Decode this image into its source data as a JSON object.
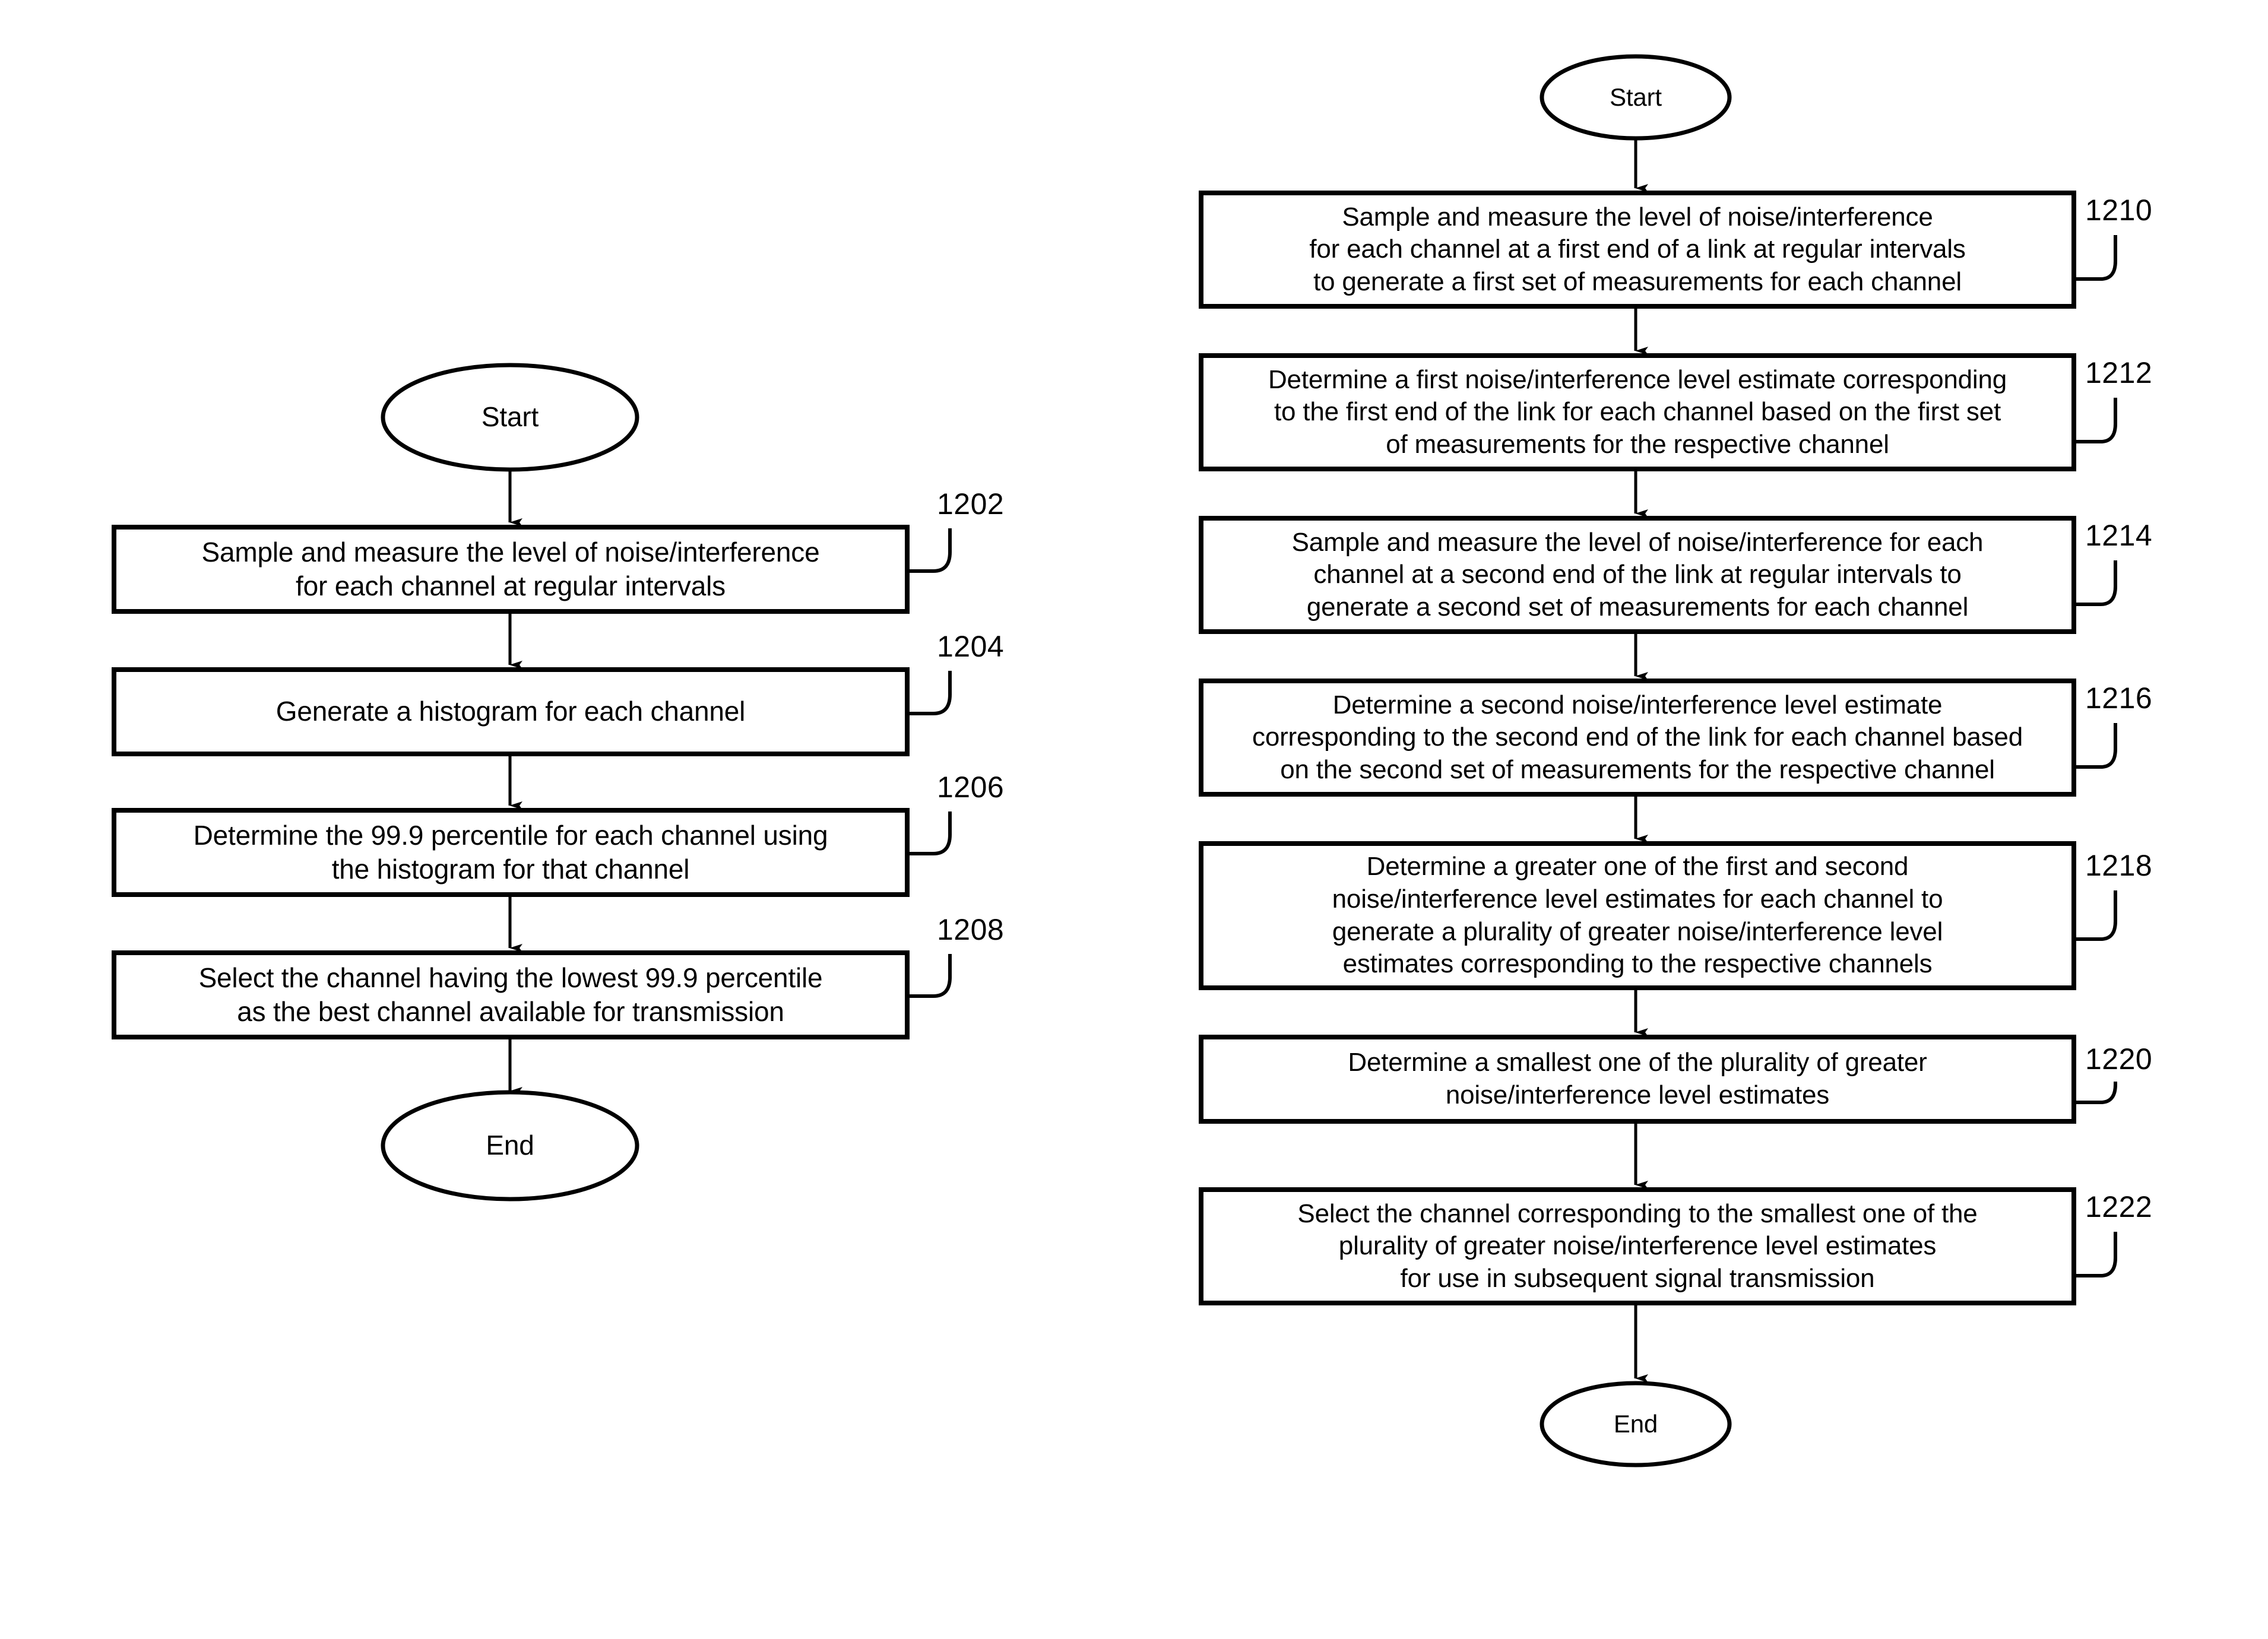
{
  "figure": {
    "type": "patent-flowchart",
    "background_color": "#ffffff",
    "line_color": "#000000",
    "text_color": "#000000"
  },
  "left_flowchart": {
    "start_label": "Start",
    "end_label": "End",
    "steps": [
      {
        "ref": "1202",
        "text": "Sample and measure the level of noise/interference\nfor each channel at regular intervals"
      },
      {
        "ref": "1204",
        "text": "Generate a histogram for each channel"
      },
      {
        "ref": "1206",
        "text": "Determine the 99.9 percentile for each channel using\nthe histogram for that channel"
      },
      {
        "ref": "1208",
        "text": "Select the channel having the lowest 99.9 percentile\nas the best channel available for transmission"
      }
    ]
  },
  "right_flowchart": {
    "start_label": "Start",
    "end_label": "End",
    "steps": [
      {
        "ref": "1210",
        "text": "Sample and measure the level of noise/interference\nfor each channel at a first end of a link at regular intervals\nto generate a first set of measurements for each channel"
      },
      {
        "ref": "1212",
        "text": "Determine a first noise/interference level estimate corresponding\nto the first end of the link for each channel based on the first set\nof measurements for the respective channel"
      },
      {
        "ref": "1214",
        "text": "Sample and measure the level of noise/interference for each\nchannel at a second end of the link at regular intervals to\ngenerate a second set of measurements for each channel"
      },
      {
        "ref": "1216",
        "text": "Determine a second noise/interference level estimate\ncorresponding to the second end of the link for each channel based\non the second set of measurements for the respective channel"
      },
      {
        "ref": "1218",
        "text": "Determine a greater one of the first and second\nnoise/interference level estimates for each channel to\ngenerate a plurality of greater noise/interference level\nestimates corresponding to the respective channels"
      },
      {
        "ref": "1220",
        "text": "Determine a smallest one of the plurality of greater\nnoise/interference level estimates"
      },
      {
        "ref": "1222",
        "text": "Select the channel corresponding to the smallest one of the\nplurality of greater noise/interference level estimates\nfor use in subsequent signal transmission"
      }
    ]
  }
}
